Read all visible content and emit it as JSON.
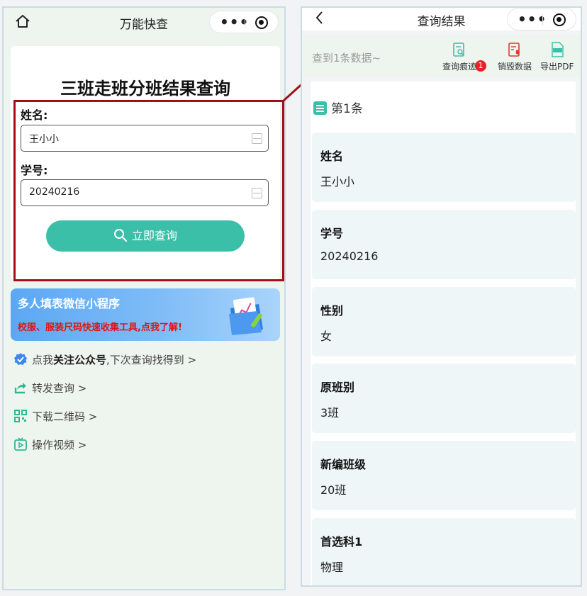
{
  "left": {
    "nav_title": "万能快查",
    "form_title": "三班走班分班结果查询",
    "name_label": "姓名:",
    "name_value": "王小小",
    "id_label": "学号:",
    "id_value": "20240216",
    "query_button": "立即查询",
    "banner": {
      "title": "多人填表微信小程序",
      "subtitle": "校服、服装尺码快速收集工具,点我了解!"
    },
    "links": {
      "follow_prefix": "点我",
      "follow_bold": "关注公众号",
      "follow_suffix": ",下次查询找得到 >",
      "share": "转发查询 >",
      "qrcode": "下载二维码 >",
      "video": "操作视频 >"
    }
  },
  "right": {
    "nav_title": "查询结果",
    "result_count": "查到1条数据~",
    "tools": {
      "trace": "查询痕迹",
      "trace_badge": "1",
      "destroy": "销毁数据",
      "export": "导出PDF"
    },
    "record_title": "第1条",
    "fields": [
      {
        "key": "姓名",
        "value": "王小小"
      },
      {
        "key": "学号",
        "value": "20240216"
      },
      {
        "key": "性别",
        "value": "女"
      },
      {
        "key": "原班别",
        "value": "3班"
      },
      {
        "key": "新编班级",
        "value": "20班"
      },
      {
        "key": "首选科1",
        "value": "物理"
      }
    ]
  },
  "colors": {
    "accent": "#3bbfa9",
    "highlight_border": "#a40f16",
    "banner_red": "#e01414"
  }
}
